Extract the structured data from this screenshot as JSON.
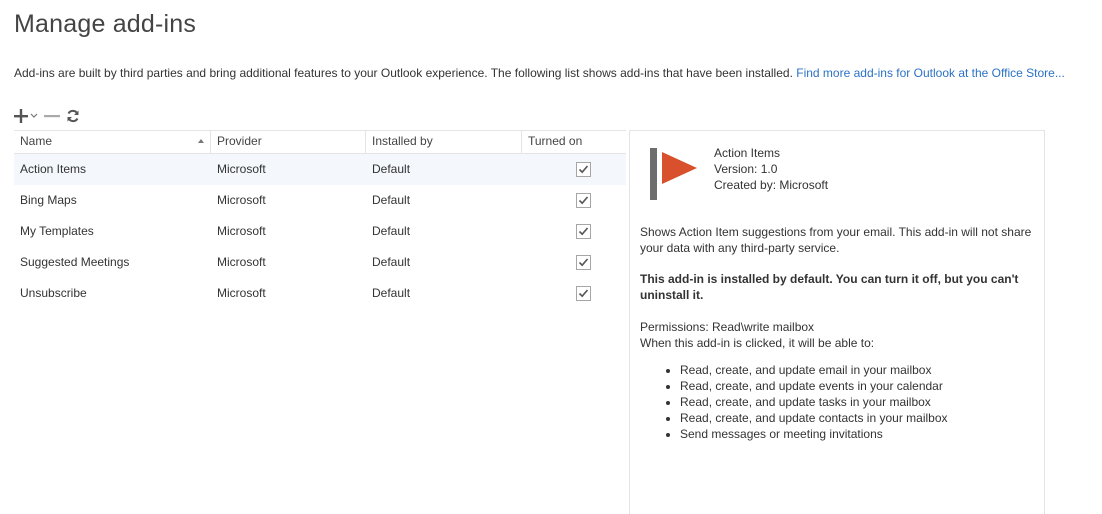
{
  "page": {
    "title": "Manage add-ins"
  },
  "intro": {
    "text": "Add-ins are built by third parties and bring additional features to your Outlook experience. The following list shows add-ins that have been installed.",
    "link_text": "Find more add-ins for Outlook at the Office Store..."
  },
  "toolbar": {
    "add_icon": "plus-icon",
    "dropdown_icon": "chevron-down-icon",
    "remove_icon": "minus-icon",
    "refresh_icon": "refresh-icon"
  },
  "grid": {
    "columns": [
      "Name",
      "Provider",
      "Installed by",
      "Turned on"
    ],
    "rows": [
      {
        "name": "Action Items",
        "provider": "Microsoft",
        "installed_by": "Default",
        "turned_on": true,
        "selected": true
      },
      {
        "name": "Bing Maps",
        "provider": "Microsoft",
        "installed_by": "Default",
        "turned_on": true,
        "selected": false
      },
      {
        "name": "My Templates",
        "provider": "Microsoft",
        "installed_by": "Default",
        "turned_on": true,
        "selected": false
      },
      {
        "name": "Suggested Meetings",
        "provider": "Microsoft",
        "installed_by": "Default",
        "turned_on": true,
        "selected": false
      },
      {
        "name": "Unsubscribe",
        "provider": "Microsoft",
        "installed_by": "Default",
        "turned_on": true,
        "selected": false
      }
    ]
  },
  "details": {
    "logo_icon": "flag-icon",
    "name": "Action Items",
    "version": "Version: 1.0",
    "created_by": "Created by: Microsoft",
    "description": "Shows Action Item suggestions from your email. This add-in will not share your data with any third-party service.",
    "default_note": "This add-in is installed by default. You can turn it off, but you can't uninstall it.",
    "permissions": "Permissions: Read\\write mailbox",
    "permissions_intro": "When this add-in is clicked, it will be able to:",
    "permissions_list": [
      "Read, create, and update email in your mailbox",
      "Read, create, and update events in your calendar",
      "Read, create, and update tasks in your mailbox",
      "Read, create, and update contacts in your mailbox",
      "Send messages or meeting invitations"
    ]
  },
  "colors": {
    "link": "#2a72c5",
    "flag_red": "#d9512c",
    "flag_pole": "#6d6d6d",
    "selected_row": "#f4f7fb"
  }
}
